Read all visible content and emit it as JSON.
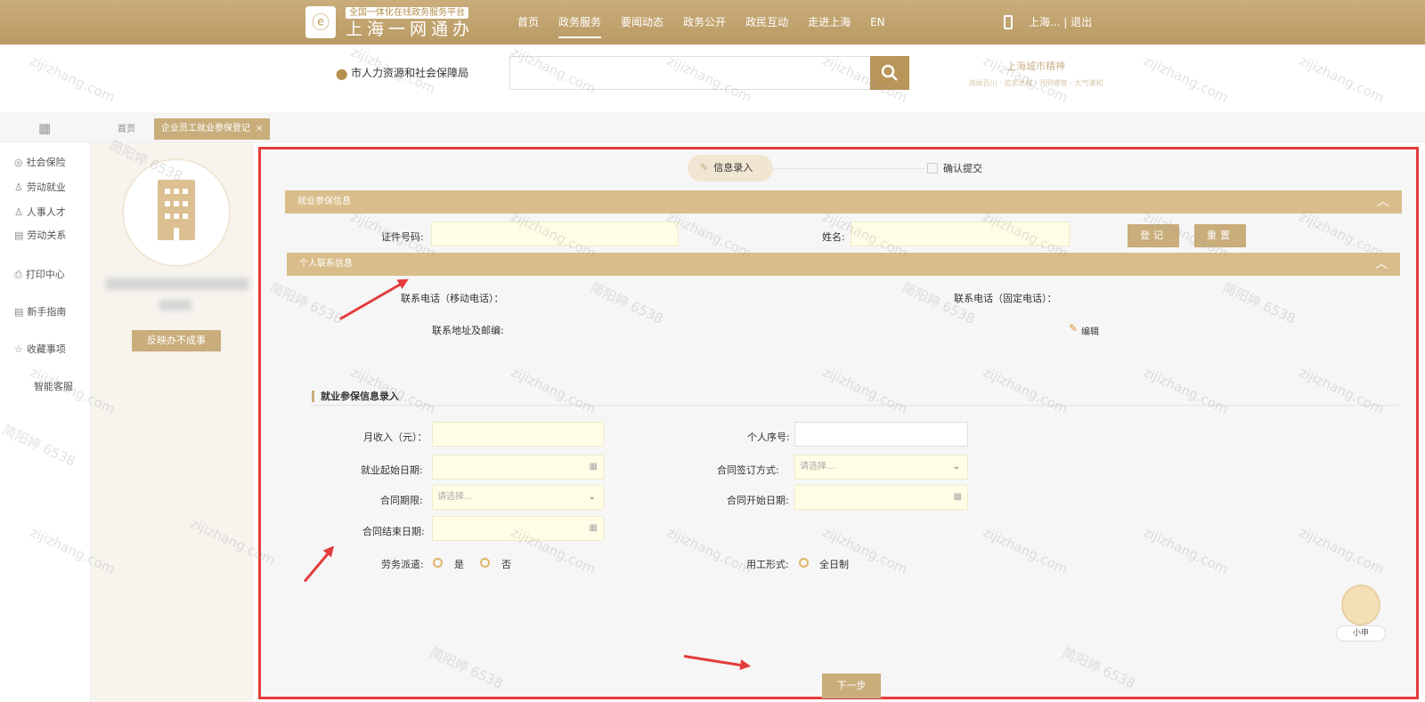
{
  "header": {
    "logo_glyph": "ⓔ",
    "logo_subtitle": "全国一体化在线政务服务平台",
    "logo_title": "上海一网通办",
    "nav": [
      "首页",
      "政务服务",
      "要闻动态",
      "政务公开",
      "政民互动",
      "走进上海",
      "EN"
    ],
    "active_nav": "政务服务",
    "user_text": "上海... | 退出"
  },
  "search": {
    "location": "市人力资源和社会保障局",
    "placeholder": "",
    "slogan": "上海城市精神",
    "slogan_sub": "海纳百川 · 追求卓越 · 开明睿智 · 大气谦和"
  },
  "tabs": {
    "home": "首页",
    "active": "企业员工就业参保登记",
    "close": "×"
  },
  "sidebar": {
    "items": [
      {
        "icon": "◎",
        "label": "社会保险"
      },
      {
        "icon": "♙",
        "label": "劳动就业"
      },
      {
        "icon": "♙",
        "label": "人事人才"
      },
      {
        "icon": "▤",
        "label": "劳动关系"
      },
      {
        "icon": "⎙",
        "label": "打印中心"
      },
      {
        "icon": "▤",
        "label": "新手指南"
      },
      {
        "icon": "☆",
        "label": "收藏事项"
      },
      {
        "icon": "",
        "label": "智能客服"
      }
    ]
  },
  "profile": {
    "feedback_label": "反映办不成事"
  },
  "steps": {
    "step1_icon": "✎",
    "step1": "信息录入",
    "step2": "确认提交"
  },
  "section1": {
    "title": "就业参保信息",
    "toggle": "︿",
    "id_label": "证件号码:",
    "name_label": "姓名:",
    "register_label": "登记",
    "reset_label": "重置"
  },
  "section2": {
    "title": "个人联系信息",
    "toggle": "︿",
    "mobile_label": "联系电话（移动电话）：",
    "fixed_label": "联系电话（固定电话）：",
    "address_label": "联系地址及邮编:",
    "edit_icon": "✎",
    "edit_label": "编辑"
  },
  "form": {
    "title": "就业参保信息录入",
    "monthly_income_label": "月收入（元）：",
    "personal_no_label": "个人序号:",
    "start_date_label": "就业起始日期:",
    "sign_method_label": "合同签订方式:",
    "sign_method_placeholder": "请选择...",
    "term_label": "合同期限:",
    "term_placeholder": "请选择...",
    "contract_start_label": "合同开始日期:",
    "contract_end_label": "合同结束日期:",
    "dispatch_label": "劳务派遣:",
    "dispatch_yes": "是",
    "dispatch_no": "否",
    "employment_form_label": "用工形式:",
    "employment_form_value": "全日制",
    "calendar_icon": "▦",
    "chevron_icon": "⌄"
  },
  "footer": {
    "next_label": "下一步",
    "assistant_label": "小申"
  },
  "watermark": {
    "text1": "zijizhang.com",
    "text2": "简阳婷 6538"
  }
}
